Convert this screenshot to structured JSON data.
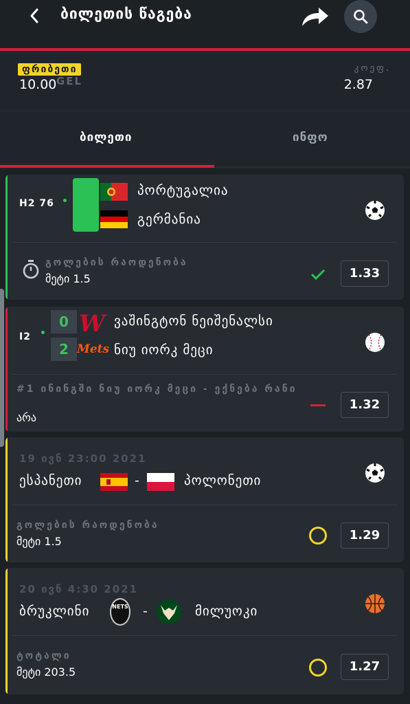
{
  "header": {
    "title": "ბილეთის წაგება",
    "back_icon": "chevron-left-icon",
    "share_icon": "share-arrow-icon",
    "search_icon": "search-icon"
  },
  "summary": {
    "freebet_label": "ფრიბეთი",
    "amount": "10.00",
    "currency": "GEL",
    "coef_label": "კოეფ.",
    "coef_value": "2.87"
  },
  "tabs": [
    {
      "label": "ბილეთი",
      "active": true
    },
    {
      "label": "ინფო",
      "active": false
    }
  ],
  "colors": {
    "accent_red": "#d81e3c",
    "accent_green": "#2bc154",
    "accent_yellow": "#f5d328"
  },
  "bets": [
    {
      "status": "live",
      "time": "H2 76",
      "sport_icon": "soccer-ball-icon",
      "team1": "პორტუგალია",
      "team2": "გერმანია",
      "market_icon": "stopwatch-icon",
      "market": "გოლების რაოდენობა",
      "selection": "მეტი 1.5",
      "result_icon": "checkmark-icon",
      "odd": "1.33"
    },
    {
      "status": "live",
      "time": "I2",
      "sport_icon": "baseball-icon",
      "score1": "0",
      "score2": "2",
      "team1": "ვაშინგტონ ნეიშენალსი",
      "team2": "ნიუ იორკ მეცი",
      "logo2_text": "Mets",
      "market": "#1 ინინგში ნიუ იორკ მეცი - ექნება რანი",
      "selection": "არა",
      "result_icon": "minus-icon",
      "odd": "1.32"
    },
    {
      "status": "pending",
      "date": "19 ივნ 23:00 2021",
      "sport_icon": "soccer-ball-icon",
      "team1": "ესპანეთი",
      "separator": "-",
      "team2": "პოლონეთი",
      "market": "გოლების რაოდენობა",
      "selection": "მეტი 1.5",
      "result_icon": "pending-circle-icon",
      "odd": "1.29"
    },
    {
      "status": "pending",
      "date": "20 ივნ 4:30 2021",
      "sport_icon": "basketball-icon",
      "team1": "ბრუკლინი",
      "separator": "-",
      "team2": "მილუოკი",
      "logo1_text": "NETS",
      "market": "ტოტალი",
      "selection": "მეტი 203.5",
      "result_icon": "pending-circle-icon",
      "odd": "1.27"
    }
  ]
}
